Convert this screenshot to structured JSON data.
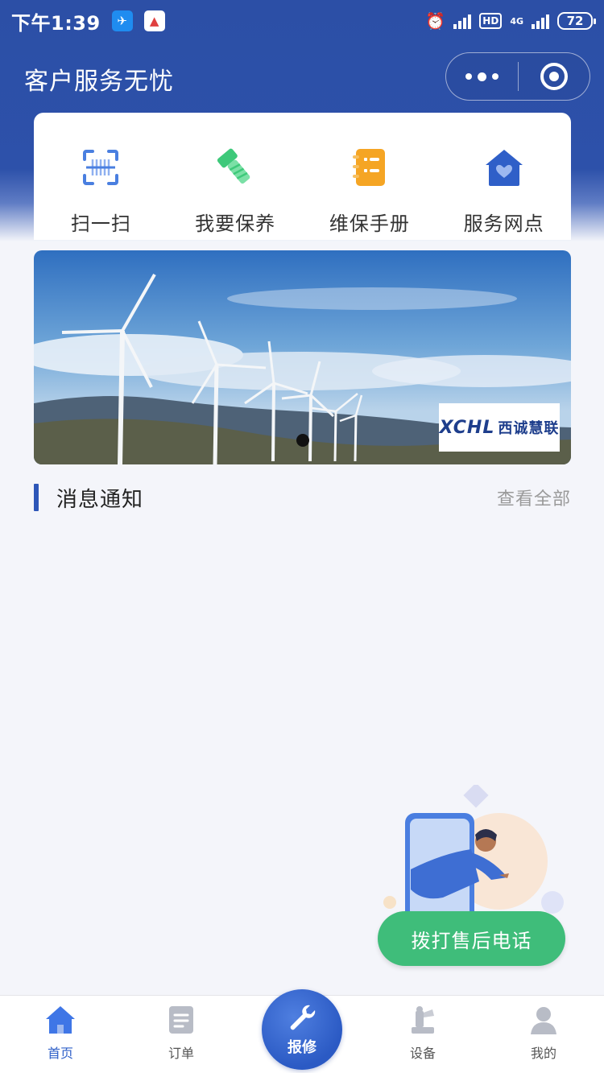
{
  "status_bar": {
    "time": "下午1:39",
    "network": "4G",
    "hd": "HD",
    "battery": "72"
  },
  "header": {
    "title": "客户服务无忧"
  },
  "quick_menu": [
    {
      "label": "扫一扫",
      "icon": "scan-icon"
    },
    {
      "label": "我要保养",
      "icon": "bolt-icon"
    },
    {
      "label": "维保手册",
      "icon": "manual-icon"
    },
    {
      "label": "服务网点",
      "icon": "home-heart-icon"
    }
  ],
  "banner": {
    "logo_text": "XCHL",
    "logo_cn": "西诚慧联"
  },
  "notice": {
    "title": "消息通知",
    "more_label": "查看全部"
  },
  "call_button": {
    "label": "拨打售后电话"
  },
  "tabbar": {
    "items": [
      {
        "label": "首页",
        "icon": "home-icon",
        "active": true
      },
      {
        "label": "订单",
        "icon": "order-icon",
        "active": false
      },
      {
        "label": "报修",
        "icon": "wrench-icon",
        "active": false
      },
      {
        "label": "设备",
        "icon": "device-icon",
        "active": false
      },
      {
        "label": "我的",
        "icon": "user-icon",
        "active": false
      }
    ]
  },
  "colors": {
    "primary": "#2d51aa",
    "accent_green": "#3fbd7a",
    "scan": "#4a7fe0",
    "bolt": "#3ec97a",
    "manual": "#f5a524",
    "home": "#2f5fc8"
  }
}
